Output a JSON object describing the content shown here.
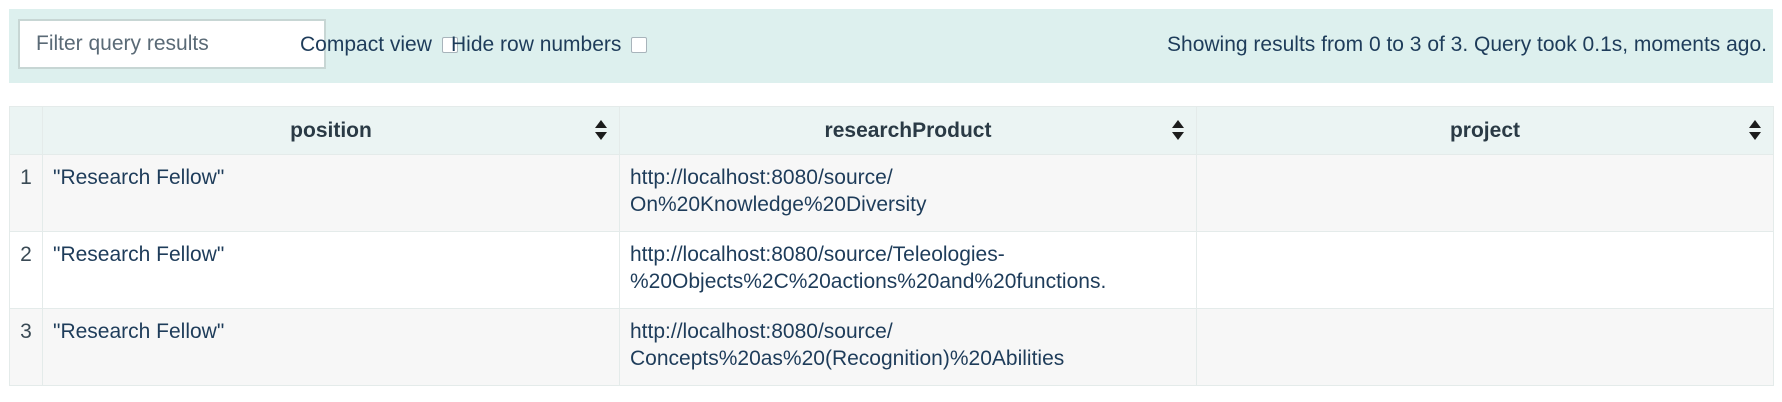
{
  "filter": {
    "placeholder": "Filter query results",
    "value": ""
  },
  "options": {
    "compact_view": {
      "label": "Compact view",
      "checked": false
    },
    "hide_row_numbers": {
      "label": "Hide row numbers",
      "checked": false
    }
  },
  "status": "Showing results from 0 to 3 of 3. Query took 0.1s, moments ago.",
  "table": {
    "columns": [
      "position",
      "researchProduct",
      "project"
    ],
    "rows": [
      {
        "num": "1",
        "position": "\"Research Fellow\"",
        "product_line1": "http://localhost:8080/source/",
        "product_line2": "On%20Knowledge%20Diversity",
        "project": ""
      },
      {
        "num": "2",
        "position": "\"Research Fellow\"",
        "product_line1": "http://localhost:8080/source/Teleologies-",
        "product_line2": "%20Objects%2C%20actions%20and%20functions.",
        "project": ""
      },
      {
        "num": "3",
        "position": "\"Research Fellow\"",
        "product_line1": "http://localhost:8080/source/",
        "product_line2": "Concepts%20as%20(Recognition)%20Abilities",
        "project": ""
      }
    ]
  }
}
